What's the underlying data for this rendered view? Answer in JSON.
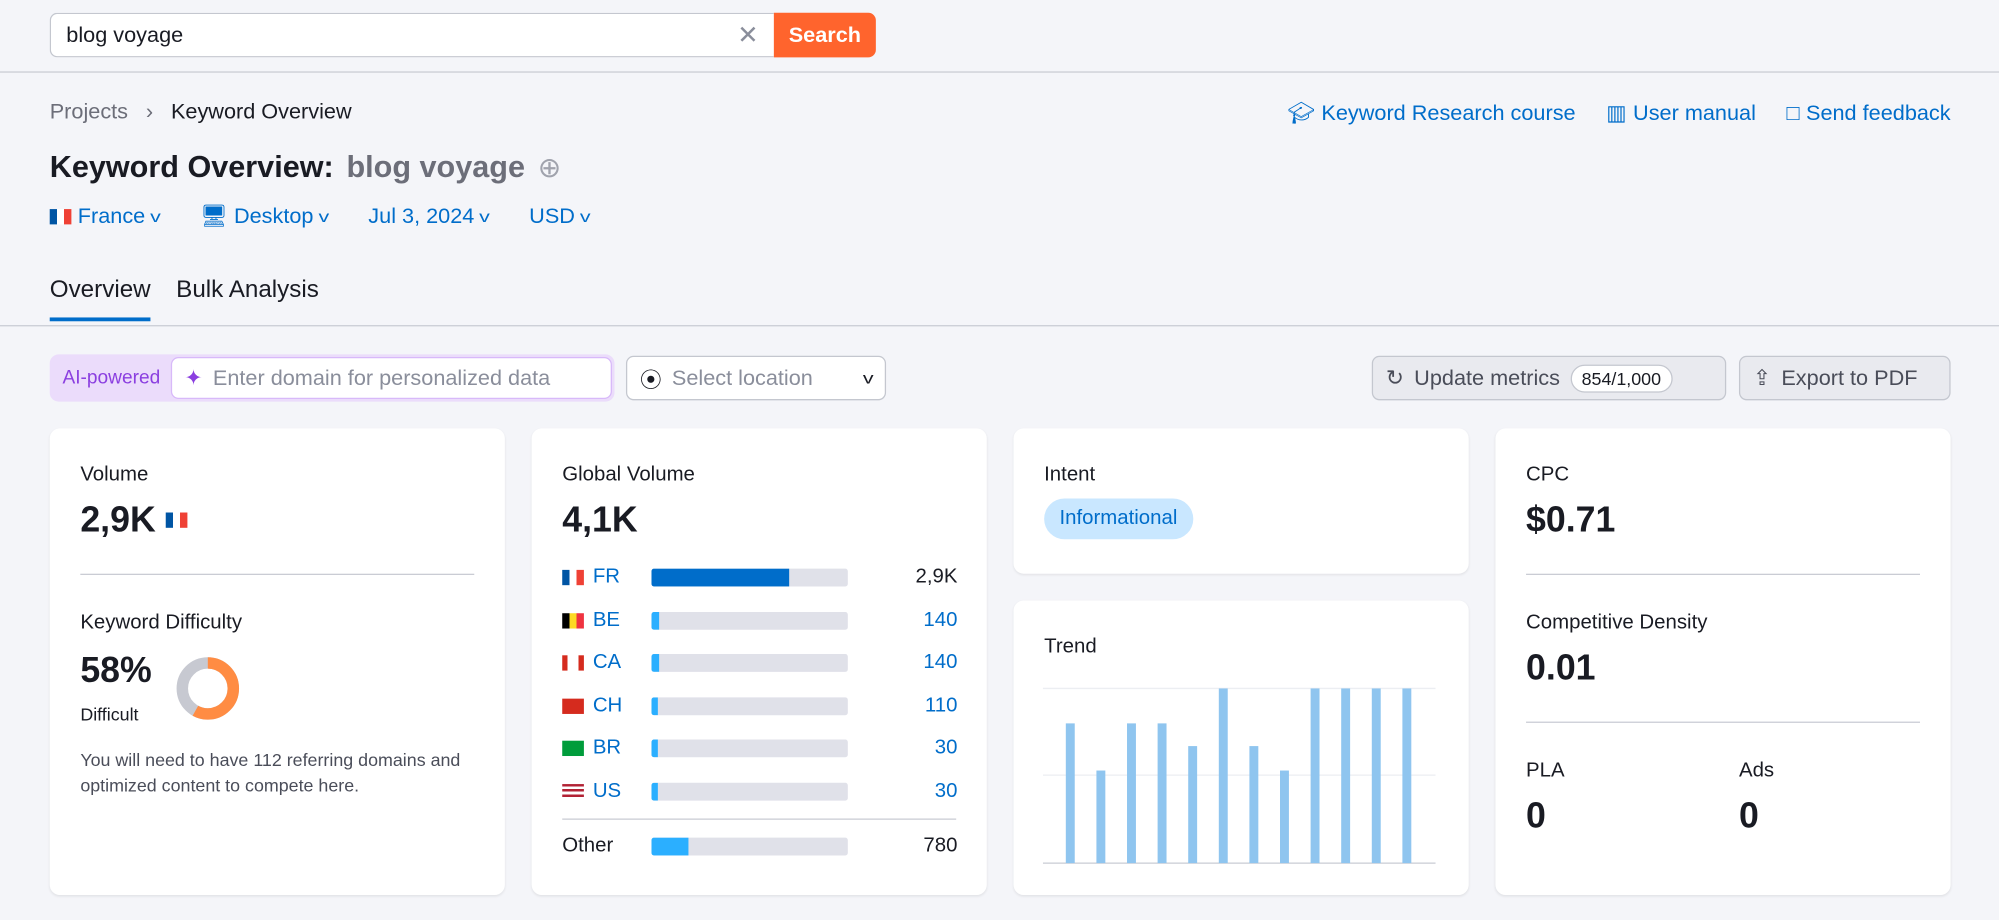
{
  "search": {
    "value": "blog voyage",
    "button": "Search"
  },
  "breadcrumb": [
    "Projects",
    "Keyword Overview"
  ],
  "header_links": [
    "Keyword Research course",
    "User manual",
    "Send feedback"
  ],
  "title": {
    "prefix": "Keyword Overview:",
    "keyword": "blog voyage"
  },
  "filters": {
    "country": "France",
    "device": "Desktop",
    "date": "Jul 3, 2024",
    "currency": "USD"
  },
  "tabs": [
    "Overview",
    "Bulk Analysis"
  ],
  "ai": {
    "label": "AI-powered",
    "placeholder": "Enter domain for personalized data"
  },
  "location": {
    "placeholder": "Select location"
  },
  "actions": {
    "update": "Update metrics",
    "credits": "854/1,000",
    "export": "Export to PDF"
  },
  "volume": {
    "label": "Volume",
    "value": "2,9K"
  },
  "kd": {
    "label": "Keyword Difficulty",
    "value": "58%",
    "percent": 58,
    "level": "Difficult",
    "note": "You will need to have 112 referring domains and optimized content to compete here.",
    "color": "#ff8c43"
  },
  "global": {
    "label": "Global Volume",
    "value": "4,1K",
    "rows": [
      {
        "code": "FR",
        "value": "2,9K",
        "share": 70
      },
      {
        "code": "BE",
        "value": "140",
        "share": 4
      },
      {
        "code": "CA",
        "value": "140",
        "share": 4
      },
      {
        "code": "CH",
        "value": "110",
        "share": 3.5
      },
      {
        "code": "BR",
        "value": "30",
        "share": 3
      },
      {
        "code": "US",
        "value": "30",
        "share": 3
      }
    ],
    "other": {
      "label": "Other",
      "value": "780",
      "share": 19
    }
  },
  "intent": {
    "label": "Intent",
    "value": "Informational"
  },
  "trend": {
    "label": "Trend",
    "values": [
      0.8,
      0.53,
      0.8,
      0.8,
      0.67,
      1,
      0.67,
      0.53,
      1,
      1,
      1,
      1
    ],
    "color": "#8fc5ef"
  },
  "cpc": {
    "label": "CPC",
    "value": "$0.71"
  },
  "density": {
    "label": "Competitive Density",
    "value": "0.01"
  },
  "pla": {
    "label": "PLA",
    "value": "0"
  },
  "ads": {
    "label": "Ads",
    "value": "0"
  }
}
